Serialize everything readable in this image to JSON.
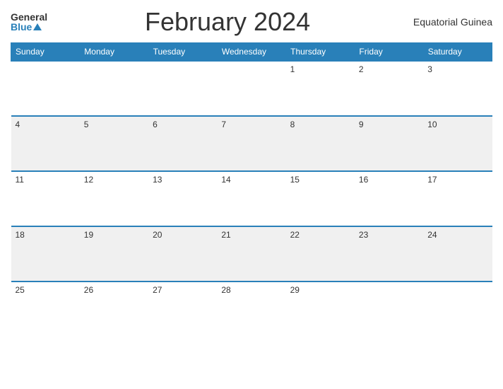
{
  "header": {
    "logo_general": "General",
    "logo_blue": "Blue",
    "month_title": "February 2024",
    "country": "Equatorial Guinea"
  },
  "weekdays": [
    "Sunday",
    "Monday",
    "Tuesday",
    "Wednesday",
    "Thursday",
    "Friday",
    "Saturday"
  ],
  "weeks": [
    [
      "",
      "",
      "",
      "",
      "1",
      "2",
      "3"
    ],
    [
      "4",
      "5",
      "6",
      "7",
      "8",
      "9",
      "10"
    ],
    [
      "11",
      "12",
      "13",
      "14",
      "15",
      "16",
      "17"
    ],
    [
      "18",
      "19",
      "20",
      "21",
      "22",
      "23",
      "24"
    ],
    [
      "25",
      "26",
      "27",
      "28",
      "29",
      "",
      ""
    ]
  ]
}
